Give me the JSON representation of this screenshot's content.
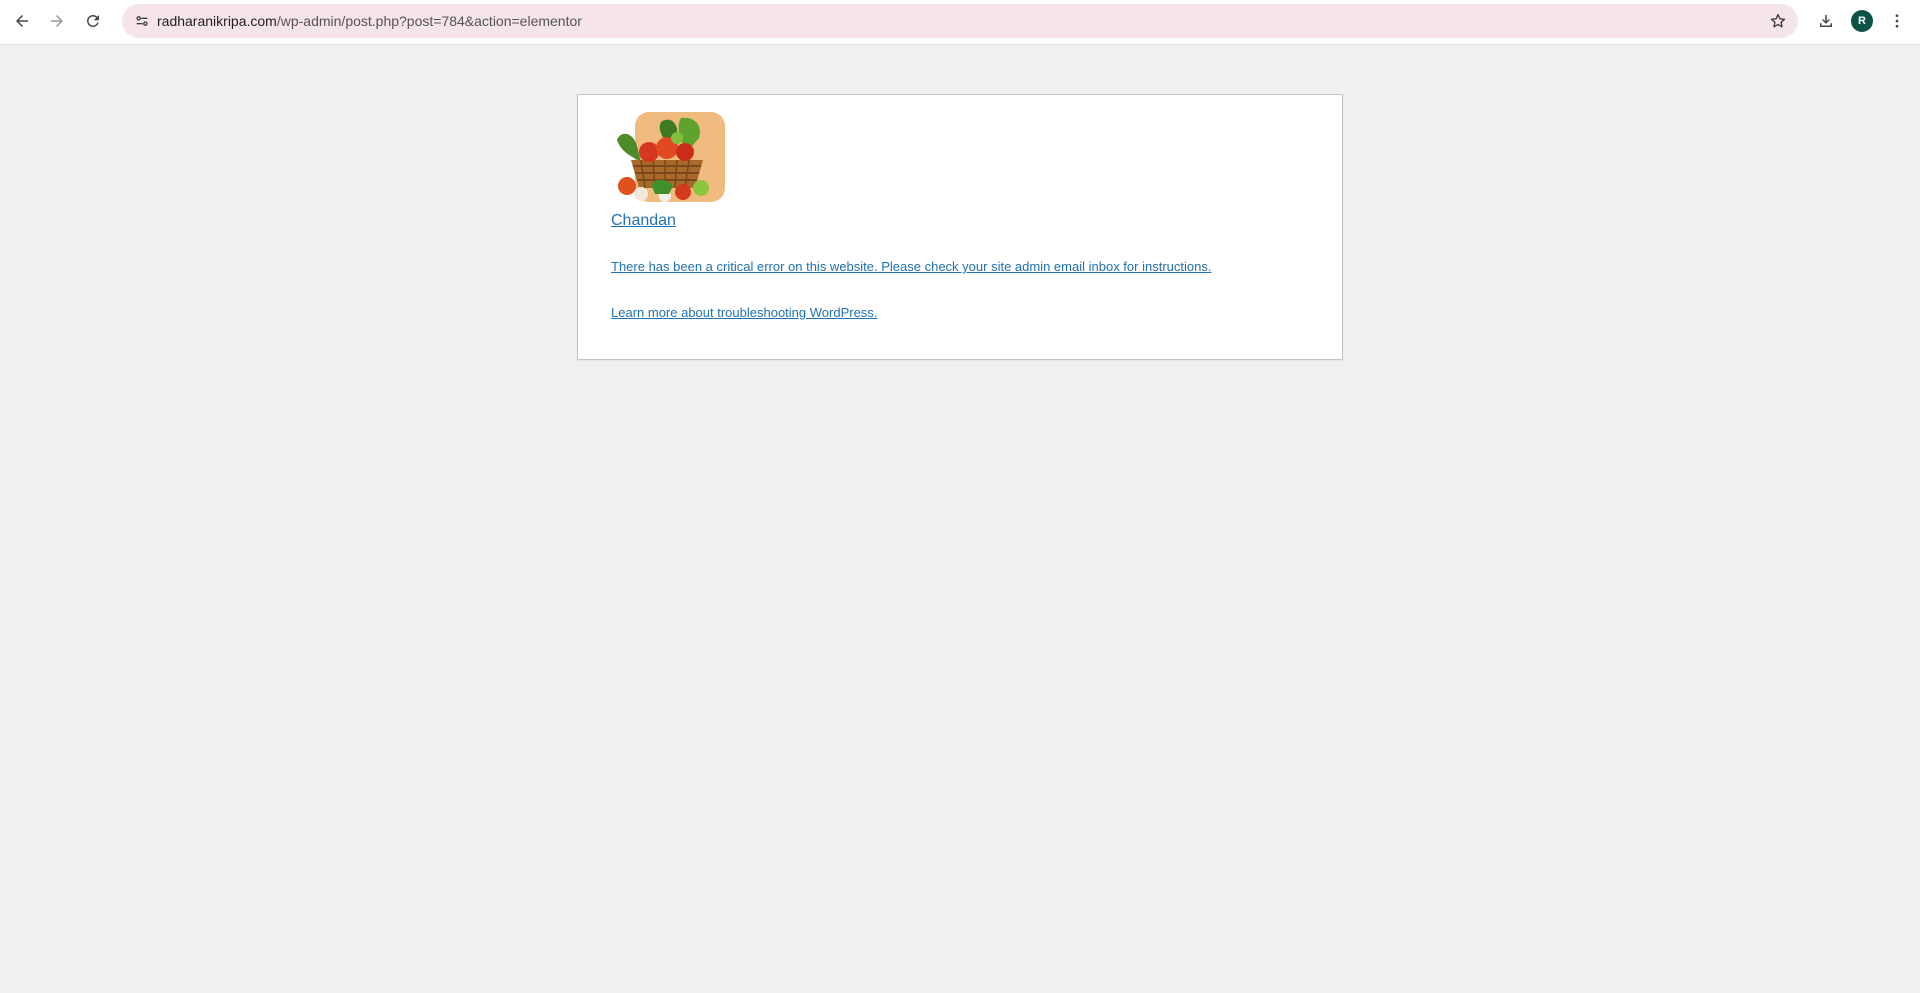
{
  "browser": {
    "url_host": "radharanikripa.com",
    "url_path": "/wp-admin/post.php?post=784&action=elementor",
    "profile_initial": "R",
    "icons": {
      "back": "back-arrow-icon",
      "forward": "forward-arrow-icon",
      "reload": "reload-icon",
      "site_info": "tune-icon",
      "bookmark": "star-icon",
      "download": "download-icon",
      "menu": "kebab-menu-icon"
    },
    "colors": {
      "omnibox_bg": "#f5e4ea",
      "avatar_bg": "#0b5247"
    }
  },
  "page": {
    "site_name": "Chandan",
    "error_message": "There has been a critical error on this website. Please check your site admin email inbox for instructions.",
    "learn_more": "Learn more about troubleshooting WordPress.",
    "link_color": "#2271b1",
    "background": "#f0f0f1"
  }
}
